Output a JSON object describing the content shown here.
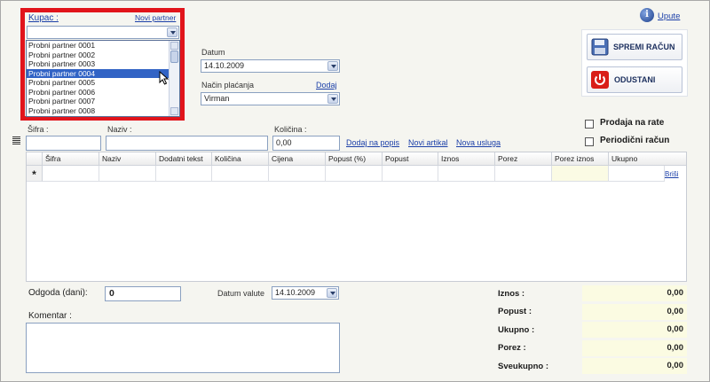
{
  "customer": {
    "label": "Kupac :",
    "new_partner": "Novi partner",
    "options": [
      "Probni partner 0001",
      "Probni partner 0002",
      "Probni partner 0003",
      "Probni partner 0004",
      "Probni partner 0005",
      "Probni partner 0006",
      "Probni partner 0007",
      "Probni partner 0008"
    ],
    "selected_index": 3
  },
  "date": {
    "label": "Datum",
    "value": "14.10.2009"
  },
  "payment": {
    "label": "Način plaćanja",
    "add": "Dodaj",
    "value": "Virman"
  },
  "help": {
    "label": "Upute"
  },
  "actions": {
    "save": "SPREMI RAČUN",
    "cancel": "ODUSTANI"
  },
  "options": {
    "installments": "Prodaja na rate",
    "periodic": "Periodični račun"
  },
  "entry": {
    "code_label": "Šifra :",
    "name_label": "Naziv :",
    "qty_label": "Količina :",
    "qty_value": "0,00",
    "add_to_list": "Dodaj na popis",
    "new_item": "Novi artikal",
    "new_service": "Nova usluga"
  },
  "grid": {
    "columns": [
      "Šifra",
      "Naziv",
      "Dodatni tekst",
      "Količina",
      "Cijena",
      "Popust (%)",
      "Popust",
      "Iznos",
      "Porez",
      "Porez iznos",
      "Ukupno"
    ],
    "new_row_marker": "*",
    "delete": "Briši"
  },
  "footer": {
    "delay_label": "Odgoda (dani):",
    "delay_value": "0",
    "value_date_label": "Datum valute",
    "value_date": "14.10.2009",
    "comment_label": "Komentar :"
  },
  "totals": [
    {
      "label": "Iznos :",
      "value": "0,00"
    },
    {
      "label": "Popust :",
      "value": "0,00"
    },
    {
      "label": "Ukupno :",
      "value": "0,00"
    },
    {
      "label": "Porez :",
      "value": "0,00"
    },
    {
      "label": "Sveukupno :",
      "value": "0,00"
    }
  ],
  "colors": {
    "highlight_frame": "#e1141b",
    "selection": "#3163c5",
    "link": "#1b3fa8"
  }
}
